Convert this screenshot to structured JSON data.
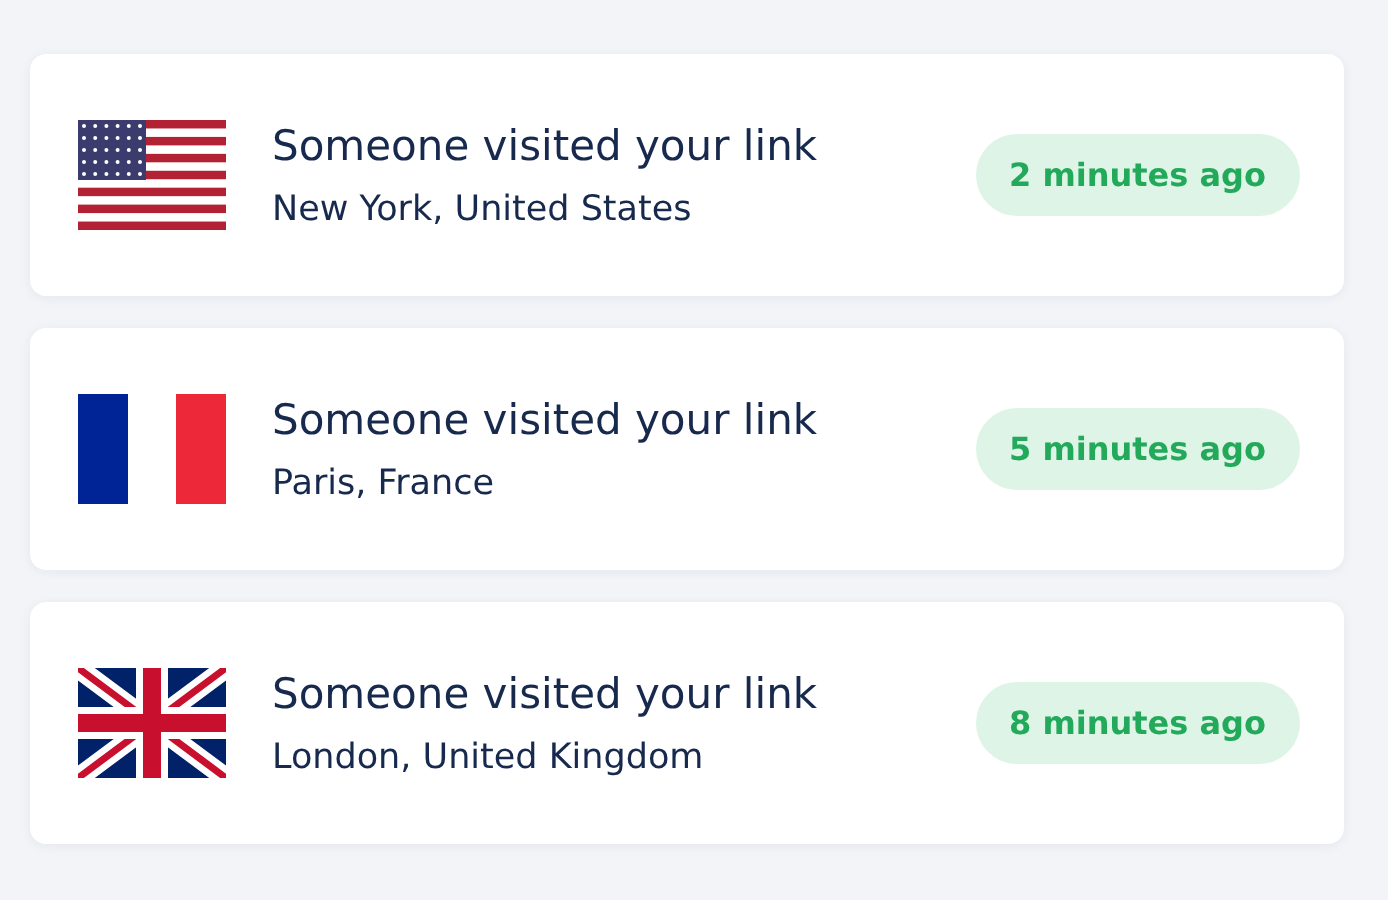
{
  "visits": [
    {
      "kind": "us",
      "title": "Someone visited your link",
      "location": "New York, United States",
      "time": "2 minutes ago"
    },
    {
      "kind": "fr",
      "title": "Someone visited your link",
      "location": "Paris, France",
      "time": "5 minutes ago"
    },
    {
      "kind": "uk",
      "title": "Someone visited your link",
      "location": "London, United Kingdom",
      "time": "8 minutes ago"
    }
  ]
}
